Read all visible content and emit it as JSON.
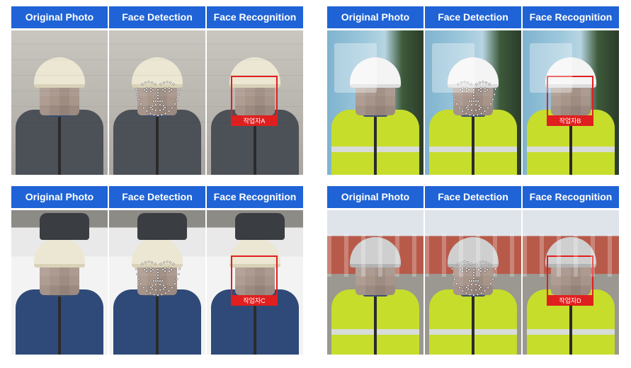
{
  "headers": [
    "Original Photo",
    "Face Detection",
    "Face Recognition"
  ],
  "groups": [
    {
      "scene": "wall",
      "outfit": "gray",
      "helmet": "beige",
      "worker_label": "작업자A"
    },
    {
      "scene": "shop",
      "outfit": "vest",
      "helmet": "white",
      "worker_label": "작업자B"
    },
    {
      "scene": "truck",
      "outfit": "navy",
      "helmet": "beige",
      "worker_label": "작업자C"
    },
    {
      "scene": "street",
      "outfit": "vest",
      "helmet": "gray",
      "worker_label": "작업자D"
    }
  ],
  "colors": {
    "header_bg": "#1f63d6",
    "header_text": "#ffffff",
    "recognition_box": "#e01f1f",
    "landmark_dot": "#ffffff"
  }
}
